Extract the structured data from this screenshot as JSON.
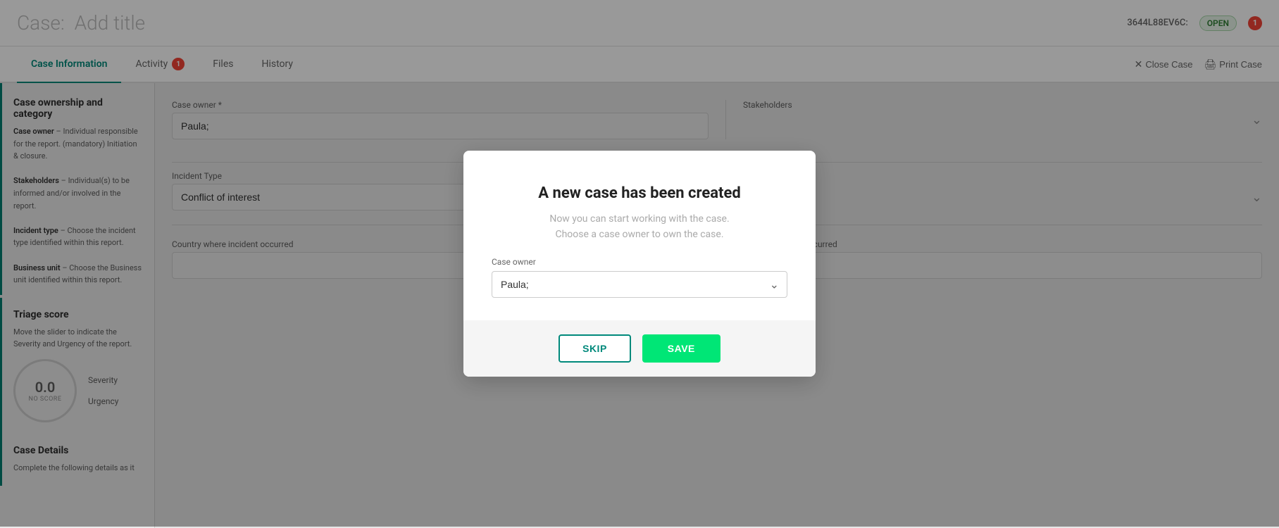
{
  "header": {
    "case_prefix": "Case:",
    "case_title": "Add title",
    "case_id": "3644L88EV6C:",
    "status": "OPEN",
    "notification_count": "1"
  },
  "tabs": [
    {
      "id": "case-information",
      "label": "Case Information",
      "active": true,
      "badge": null
    },
    {
      "id": "activity",
      "label": "Activity",
      "active": false,
      "badge": "1"
    },
    {
      "id": "files",
      "label": "Files",
      "active": false,
      "badge": null
    },
    {
      "id": "history",
      "label": "History",
      "active": false,
      "badge": null
    }
  ],
  "tab_actions": {
    "close_case": "Close Case",
    "print_case": "Print Case"
  },
  "sidebar": {
    "sections": [
      {
        "id": "ownership",
        "title": "Case ownership and category",
        "body": [
          {
            "term": "Case owner",
            "def": "– Individual responsible for the report. (mandatory) Initiation & closure."
          },
          {
            "term": "Stakeholders",
            "def": "– Individual(s) to be informed and/or involved in the report."
          },
          {
            "term": "Incident type",
            "def": "– Choose the incident type identified within this report."
          },
          {
            "term": "Business unit",
            "def": "– Choose the Business unit identified within this report."
          }
        ]
      },
      {
        "id": "triage",
        "title": "Triage score",
        "body": "Move the slider to indicate the Severity and Urgency of the report."
      },
      {
        "id": "details",
        "title": "Case Details",
        "body": "Complete the following details as it"
      }
    ]
  },
  "form": {
    "case_owner_label": "Case owner *",
    "case_owner_value": "Paula;",
    "stakeholders_label": "Stakeholders",
    "incident_type_label": "Incident Type",
    "incident_type_value": "Conflict of interest",
    "triage_score": "0.0",
    "triage_no_score": "NO SCORE",
    "severity_label": "Severity",
    "urgency_label": "Urgency",
    "country_label": "Country where incident occurred",
    "state_label": "State where incident occurred"
  },
  "modal": {
    "title": "A new case has been created",
    "subtitle1": "Now you can start working with the case.",
    "subtitle2": "Choose a case owner to own the case.",
    "case_owner_label": "Case owner",
    "case_owner_value": "Paula;",
    "skip_label": "SKIP",
    "save_label": "SAVE"
  }
}
